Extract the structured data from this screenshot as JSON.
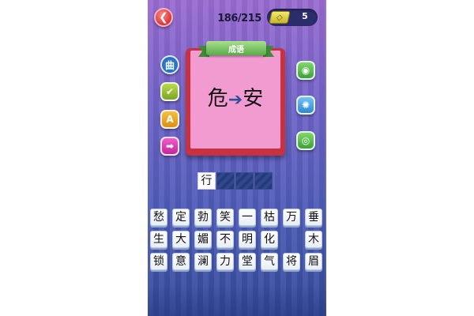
{
  "header": {
    "back_icon": "back-arrow-icon",
    "progress": "186/215",
    "coin_icon": "ticket-coin-icon",
    "coin_count": "5"
  },
  "side_left": [
    {
      "name": "dictionary-button",
      "icon": "dictionary-icon",
      "glyph": "曲"
    },
    {
      "name": "hint-check-button",
      "icon": "check-icon",
      "glyph": "✔"
    },
    {
      "name": "reveal-letter-button",
      "icon": "letter-a-icon",
      "glyph": "A"
    },
    {
      "name": "skip-button",
      "icon": "arrow-right-icon",
      "glyph": "➡"
    }
  ],
  "side_right": [
    {
      "name": "weibo-share-button",
      "icon": "weibo-icon",
      "glyph": "◉"
    },
    {
      "name": "moments-share-button",
      "icon": "camera-shutter-icon",
      "glyph": "✺"
    },
    {
      "name": "wechat-share-button",
      "icon": "wechat-icon",
      "glyph": "◎"
    }
  ],
  "puzzle": {
    "category": "成语",
    "clue_left": "危",
    "clue_arrow": "➔",
    "clue_right": "安"
  },
  "answer_slots": [
    "行",
    "",
    "",
    ""
  ],
  "char_grid": [
    [
      "愁",
      "定",
      "勃",
      "笑",
      "一",
      "枯",
      "万",
      "垂"
    ],
    [
      "生",
      "大",
      "媚",
      "不",
      "明",
      "化",
      "",
      "木"
    ],
    [
      "锁",
      "意",
      "澜",
      "力",
      "堂",
      "气",
      "将",
      "眉"
    ]
  ],
  "colors": {
    "accent_red": "#c83240",
    "card_pink": "#f19bd0",
    "ribbon_green": "#5aa94a",
    "bg_top": "#9a6bd2",
    "bg_bottom": "#344a9a"
  }
}
